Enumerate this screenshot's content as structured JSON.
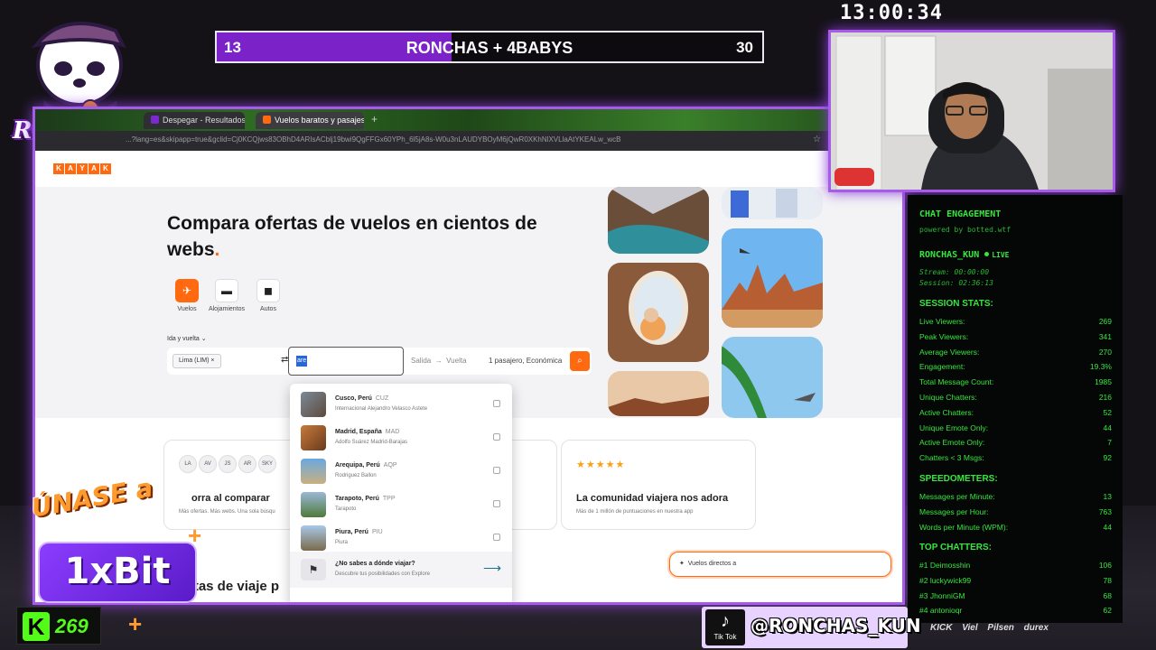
{
  "overlay": {
    "clock": "13:00:34",
    "score_bar": {
      "left_score": "13",
      "title": "RONCHAS + 4BABYS",
      "right_score": "30",
      "fill_fraction": 0.43
    },
    "streamer_logo_text": "RONCHAS",
    "promo": {
      "line1": "ÚNASE a",
      "brand": "1xBit"
    },
    "kick": {
      "viewers": "269"
    },
    "tiktok": {
      "platform": "Tik Tok",
      "handle": "@RONCHAS_KUN"
    },
    "sponsors": "KICK Viel Pilsen durex"
  },
  "browser": {
    "tabs": [
      {
        "label": "Despegar - Resultados de Vue"
      },
      {
        "label": "Vuelos baratos y pasajes aéreo"
      }
    ],
    "url": "...?lang=es&skipapp=true&gclid=Cj0KCQjws83OBhD4ARIsACblj19bwi9QgFFGx60YPh_6l5jA8s-W0u3nLAUDYBOyM6jQwR0XKhNlXVLlaAtYKEALw_wcB"
  },
  "kayak": {
    "logo_letters": [
      "K",
      "A",
      "Y",
      "A",
      "K"
    ],
    "hero_title": "Compara ofertas de vuelos en cientos de webs",
    "hero_title_dot": ".",
    "categories": [
      {
        "label": "Vuelos",
        "icon": "plane-icon"
      },
      {
        "label": "Alojamientos",
        "icon": "bed-icon"
      },
      {
        "label": "Autos",
        "icon": "car-icon"
      }
    ],
    "trip_type": "Ida y vuelta",
    "origin": "Lima (LIM)",
    "destination_input": "are",
    "date_from": "Salida",
    "date_to": "Vuelta",
    "passengers": "1 pasajero, Económica",
    "dropdown": [
      {
        "name": "Cusco, Perú",
        "code": "CUZ",
        "sub": "Internacional Alejandro Velasco Astete"
      },
      {
        "name": "Madrid, España",
        "code": "MAD",
        "sub": "Adolfo Suárez Madrid-Barajas"
      },
      {
        "name": "Arequipa, Perú",
        "code": "AQP",
        "sub": "Rodriguez Ballon"
      },
      {
        "name": "Tarapoto, Perú",
        "code": "TPP",
        "sub": "Tarapoto"
      },
      {
        "name": "Piura, Perú",
        "code": "PIU",
        "sub": "Piura"
      }
    ],
    "explore": {
      "title": "¿No sabes a dónde viajar?",
      "sub": "Descubre tus posibilidades con Explore"
    },
    "cards": [
      {
        "title": "orra al comparar",
        "sub": "Más ofertas. Más webs. Una sola búsqu"
      },
      {
        "title": "La comunidad viajera nos adora",
        "sub": "Más de 1 millón de puntuaciones en nuestra app",
        "stars": "★★★★★"
      }
    ],
    "airline_logos": [
      "LA",
      "AV",
      "JS",
      "AR",
      "SKY"
    ],
    "direct_flights": "Vuelos directos a",
    "section_fragment": "rtas de viaje p"
  },
  "chat_panel": {
    "title": "CHAT ENGAGEMENT",
    "powered": "powered by botted.wtf",
    "channel": "RONCHAS_KUN",
    "live": "LIVE",
    "stream": "Stream: 00:00:00",
    "session": "Session: 02:36:13",
    "session_stats_header": "SESSION STATS:",
    "session_stats": [
      {
        "label": "Live Viewers:",
        "value": "269"
      },
      {
        "label": "Peak Viewers:",
        "value": "341"
      },
      {
        "label": "Average Viewers:",
        "value": "270"
      },
      {
        "label": "Engagement:",
        "value": "19.3%"
      },
      {
        "label": "Total Message Count:",
        "value": "1985"
      },
      {
        "label": "Unique Chatters:",
        "value": "216"
      },
      {
        "label": "Active Chatters:",
        "value": "52"
      },
      {
        "label": "Unique Emote Only:",
        "value": "44"
      },
      {
        "label": "Active Emote Only:",
        "value": "7"
      },
      {
        "label": "Chatters < 3 Msgs:",
        "value": "92"
      }
    ],
    "speed_header": "SPEEDOMETERS:",
    "speed": [
      {
        "label": "Messages per Minute:",
        "value": "13"
      },
      {
        "label": "Messages per Hour:",
        "value": "763"
      },
      {
        "label": "Words per Minute (WPM):",
        "value": "44"
      }
    ],
    "top_header": "TOP CHATTERS:",
    "top": [
      {
        "label": "#1 Deimosshin",
        "value": "106"
      },
      {
        "label": "#2 luckywick99",
        "value": "78"
      },
      {
        "label": "#3 JhonniGM",
        "value": "68"
      },
      {
        "label": "#4 antonioqr",
        "value": "62"
      }
    ]
  },
  "colors": {
    "accent_purple": "#a65ce8",
    "kayak_orange": "#ff690f",
    "chat_green": "#37e63e",
    "kick_green": "#53fc18"
  }
}
